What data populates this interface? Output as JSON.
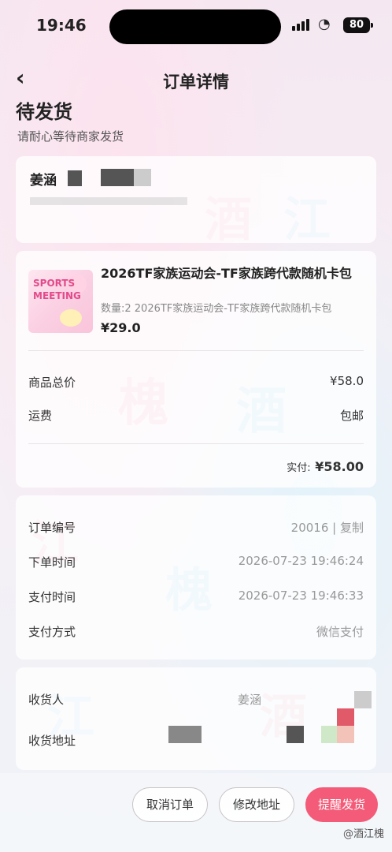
{
  "status_bar": {
    "time": "19:46",
    "battery": "80"
  },
  "nav": {
    "back_icon": "chevron-left-icon",
    "title": "订单详情"
  },
  "order_status": {
    "title": "待发货",
    "subtitle": "请耐心等待商家发货"
  },
  "buyer": {
    "name": "姜涵"
  },
  "product": {
    "image_text_1": "SPORTS",
    "image_text_2": "MEETING",
    "title": "2026TF家族运动会-TF家族跨代款随机卡包",
    "desc": "数量:2 2026TF家族运动会-TF家族跨代款随机卡包",
    "price": "¥29.0",
    "subtotal_label": "商品总价",
    "subtotal_value": "¥58.0",
    "shipping_label": "运费",
    "shipping_value": "包邮",
    "paid_label": "实付:",
    "paid_value": "¥58.00"
  },
  "order_info": {
    "number_label": "订单编号",
    "number_value": "20016",
    "copy_label": "复制",
    "created_label": "下单时间",
    "created_value": "2026-07-23 19:46:24",
    "paid_label": "支付时间",
    "paid_value": "2026-07-23 19:46:33",
    "method_label": "支付方式",
    "method_value": "微信支付"
  },
  "address": {
    "receiver_label": "收货人",
    "receiver_value": "姜涵",
    "address_label": "收货地址"
  },
  "actions": {
    "cancel": "取消订单",
    "modify": "修改地址",
    "remind": "提醒发货"
  },
  "watermark": "@酒江槐",
  "colors": {
    "primary": "#f35b78",
    "doodle_pink": "#f08aa8",
    "doodle_blue": "#7cc7e8"
  }
}
